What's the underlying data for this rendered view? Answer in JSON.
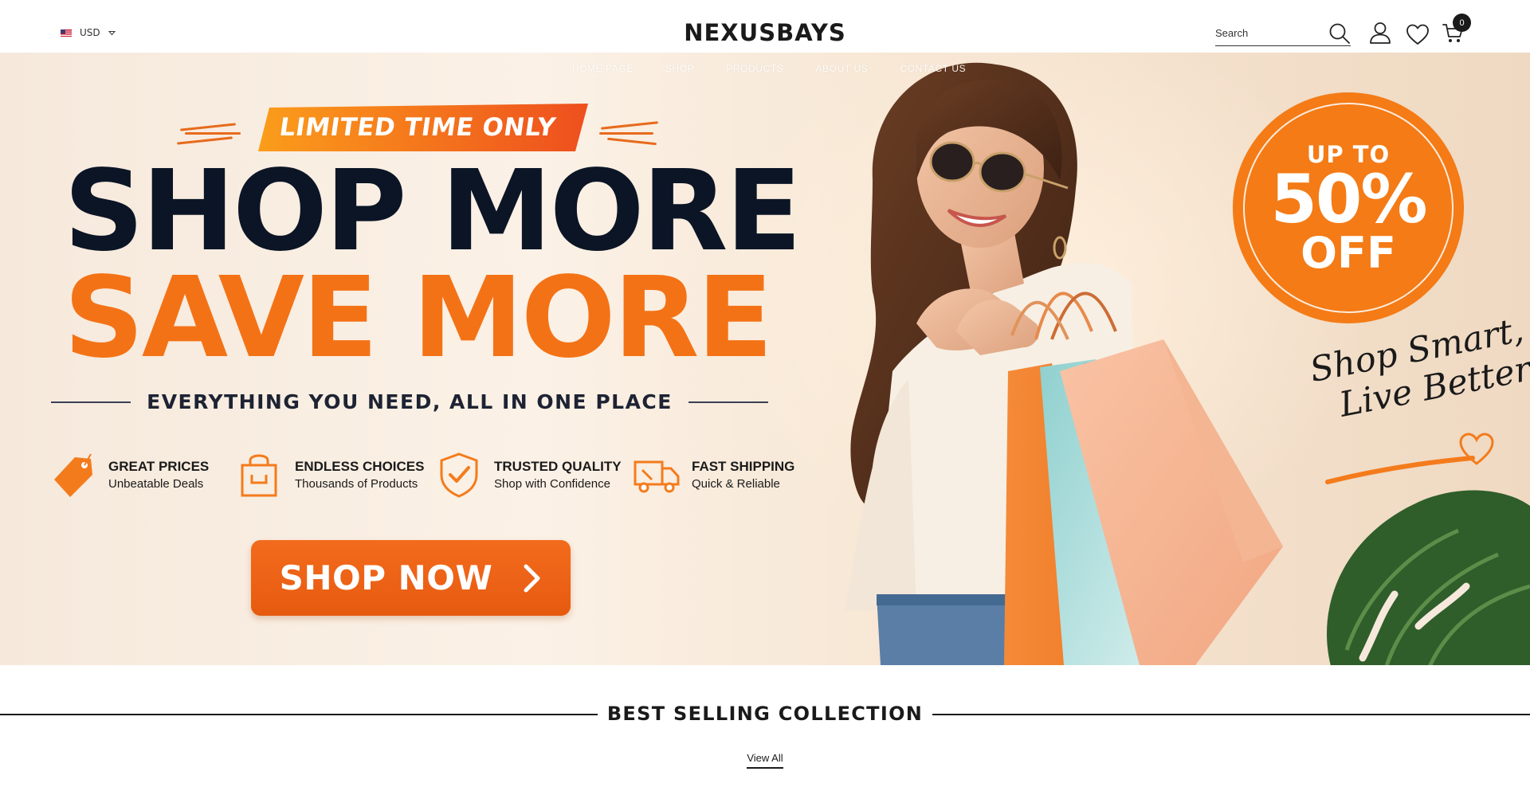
{
  "header": {
    "currency": "USD",
    "logo": "NEXUSBAYS",
    "search_placeholder": "Search",
    "cart_count": "0"
  },
  "nav": {
    "items": [
      {
        "label": "HOME PAGE"
      },
      {
        "label": "SHOP"
      },
      {
        "label": "PRODUCTS"
      },
      {
        "label": "ABOUT US"
      },
      {
        "label": "CONTACT US"
      }
    ]
  },
  "hero": {
    "ribbon": "LIMITED TIME ONLY",
    "headline_1": "SHOP MORE",
    "headline_2": "SAVE MORE",
    "tagline": "EVERYTHING YOU NEED, ALL IN ONE PLACE",
    "features": [
      {
        "title": "GREAT PRICES",
        "subtitle": "Unbeatable Deals",
        "icon": "price-tag-icon"
      },
      {
        "title": "ENDLESS CHOICES",
        "subtitle": "Thousands of Products",
        "icon": "shopping-bag-icon"
      },
      {
        "title": "TRUSTED QUALITY",
        "subtitle": "Shop with Confidence",
        "icon": "shield-check-icon"
      },
      {
        "title": "FAST SHIPPING",
        "subtitle": "Quick & Reliable",
        "icon": "delivery-truck-icon"
      }
    ],
    "cta": "SHOP NOW",
    "badge": {
      "line1": "UP TO",
      "line2": "50%",
      "line3": "OFF"
    },
    "script_line1": "Shop Smart,",
    "script_line2": "Live Better"
  },
  "section": {
    "title": "BEST SELLING COLLECTION",
    "view_all": "View All"
  },
  "colors": {
    "accent_orange": "#f47216",
    "navy": "#0b1526",
    "hero_background": "#f6e9dc"
  }
}
